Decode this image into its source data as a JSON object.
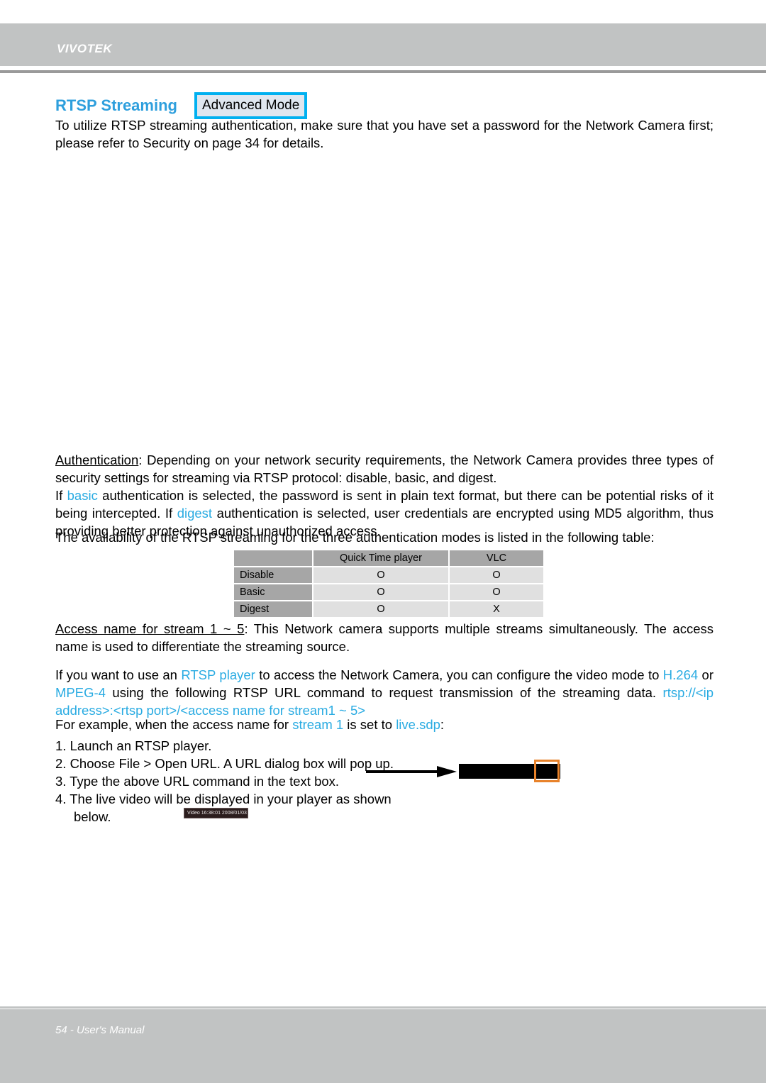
{
  "header": {
    "brand": "VIVOTEK"
  },
  "title": {
    "heading": "RTSP Streaming",
    "badge": "Advanced Mode"
  },
  "intro": {
    "text": "To utilize RTSP streaming authentication, make sure that you have set a password for the Network Camera first; please refer to Security on page 34 for details."
  },
  "authentication": {
    "label": "Authentication",
    "line1_rest": ": Depending on your network security requirements, the Network Camera provides three types of security settings for streaming via RTSP protocol: disable, basic, and digest.",
    "line2_a": "If ",
    "basic": "basic",
    "line2_b": " authentication is selected, the password is sent in plain text format, but there can be potential risks of it being intercepted. If ",
    "digest": "digest",
    "line2_c": " authentication is selected, user credentials are encrypted using MD5 algorithm, thus providing better protection against unauthorized access.",
    "line3": "The availability of the RTSP streaming for the three authentication modes is listed in the following table:"
  },
  "table": {
    "corner": "",
    "columns": [
      "Quick Time player",
      "VLC"
    ],
    "rows": [
      {
        "label": "Disable",
        "values": [
          "O",
          "O"
        ]
      },
      {
        "label": "Basic",
        "values": [
          "O",
          "O"
        ]
      },
      {
        "label": "Digest",
        "values": [
          "O",
          "X"
        ]
      }
    ]
  },
  "access_name": {
    "label": "Access name for stream 1 ~ 5",
    "rest": ": This Network camera supports multiple streams simultaneously. The access name is used to differentiate the streaming source."
  },
  "rtsp_player": {
    "a": "If you want to use an ",
    "link1": "RTSP player",
    "b": " to access the Network Camera, you can configure the video mode to ",
    "link2": "H.264",
    "c": " or ",
    "link3": "MPEG-4",
    "d": " using the following RTSP URL command to request transmission of the streaming data. ",
    "url": "rtsp://<ip address>:<rtsp port>/<access name for stream1 ~ 5>",
    "e": "For example, when the access name for ",
    "link4": "stream 1",
    "f": " is set to ",
    "link5": "live.sdp",
    "g": ":"
  },
  "steps": [
    "1. Launch an RTSP player.",
    "2. Choose File > Open URL. A URL dialog box will pop up.",
    "3. Type the above URL command in the text box.",
    "4. The live video will be displayed in your player as shown",
    "below."
  ],
  "video_stub": {
    "title": "Video 16:38:01 2008/01/03"
  },
  "footer": {
    "text": "54 - User's Manual"
  },
  "colors": {
    "accent_blue": "#2e9fdd",
    "cyan_link": "#29abe2",
    "badge_border": "#00b0f0",
    "band_gray": "#c1c3c3",
    "table_header_gray": "#a6a6a6",
    "table_cell_gray": "#e0e0e0",
    "annotation_orange": "#e8822a"
  }
}
